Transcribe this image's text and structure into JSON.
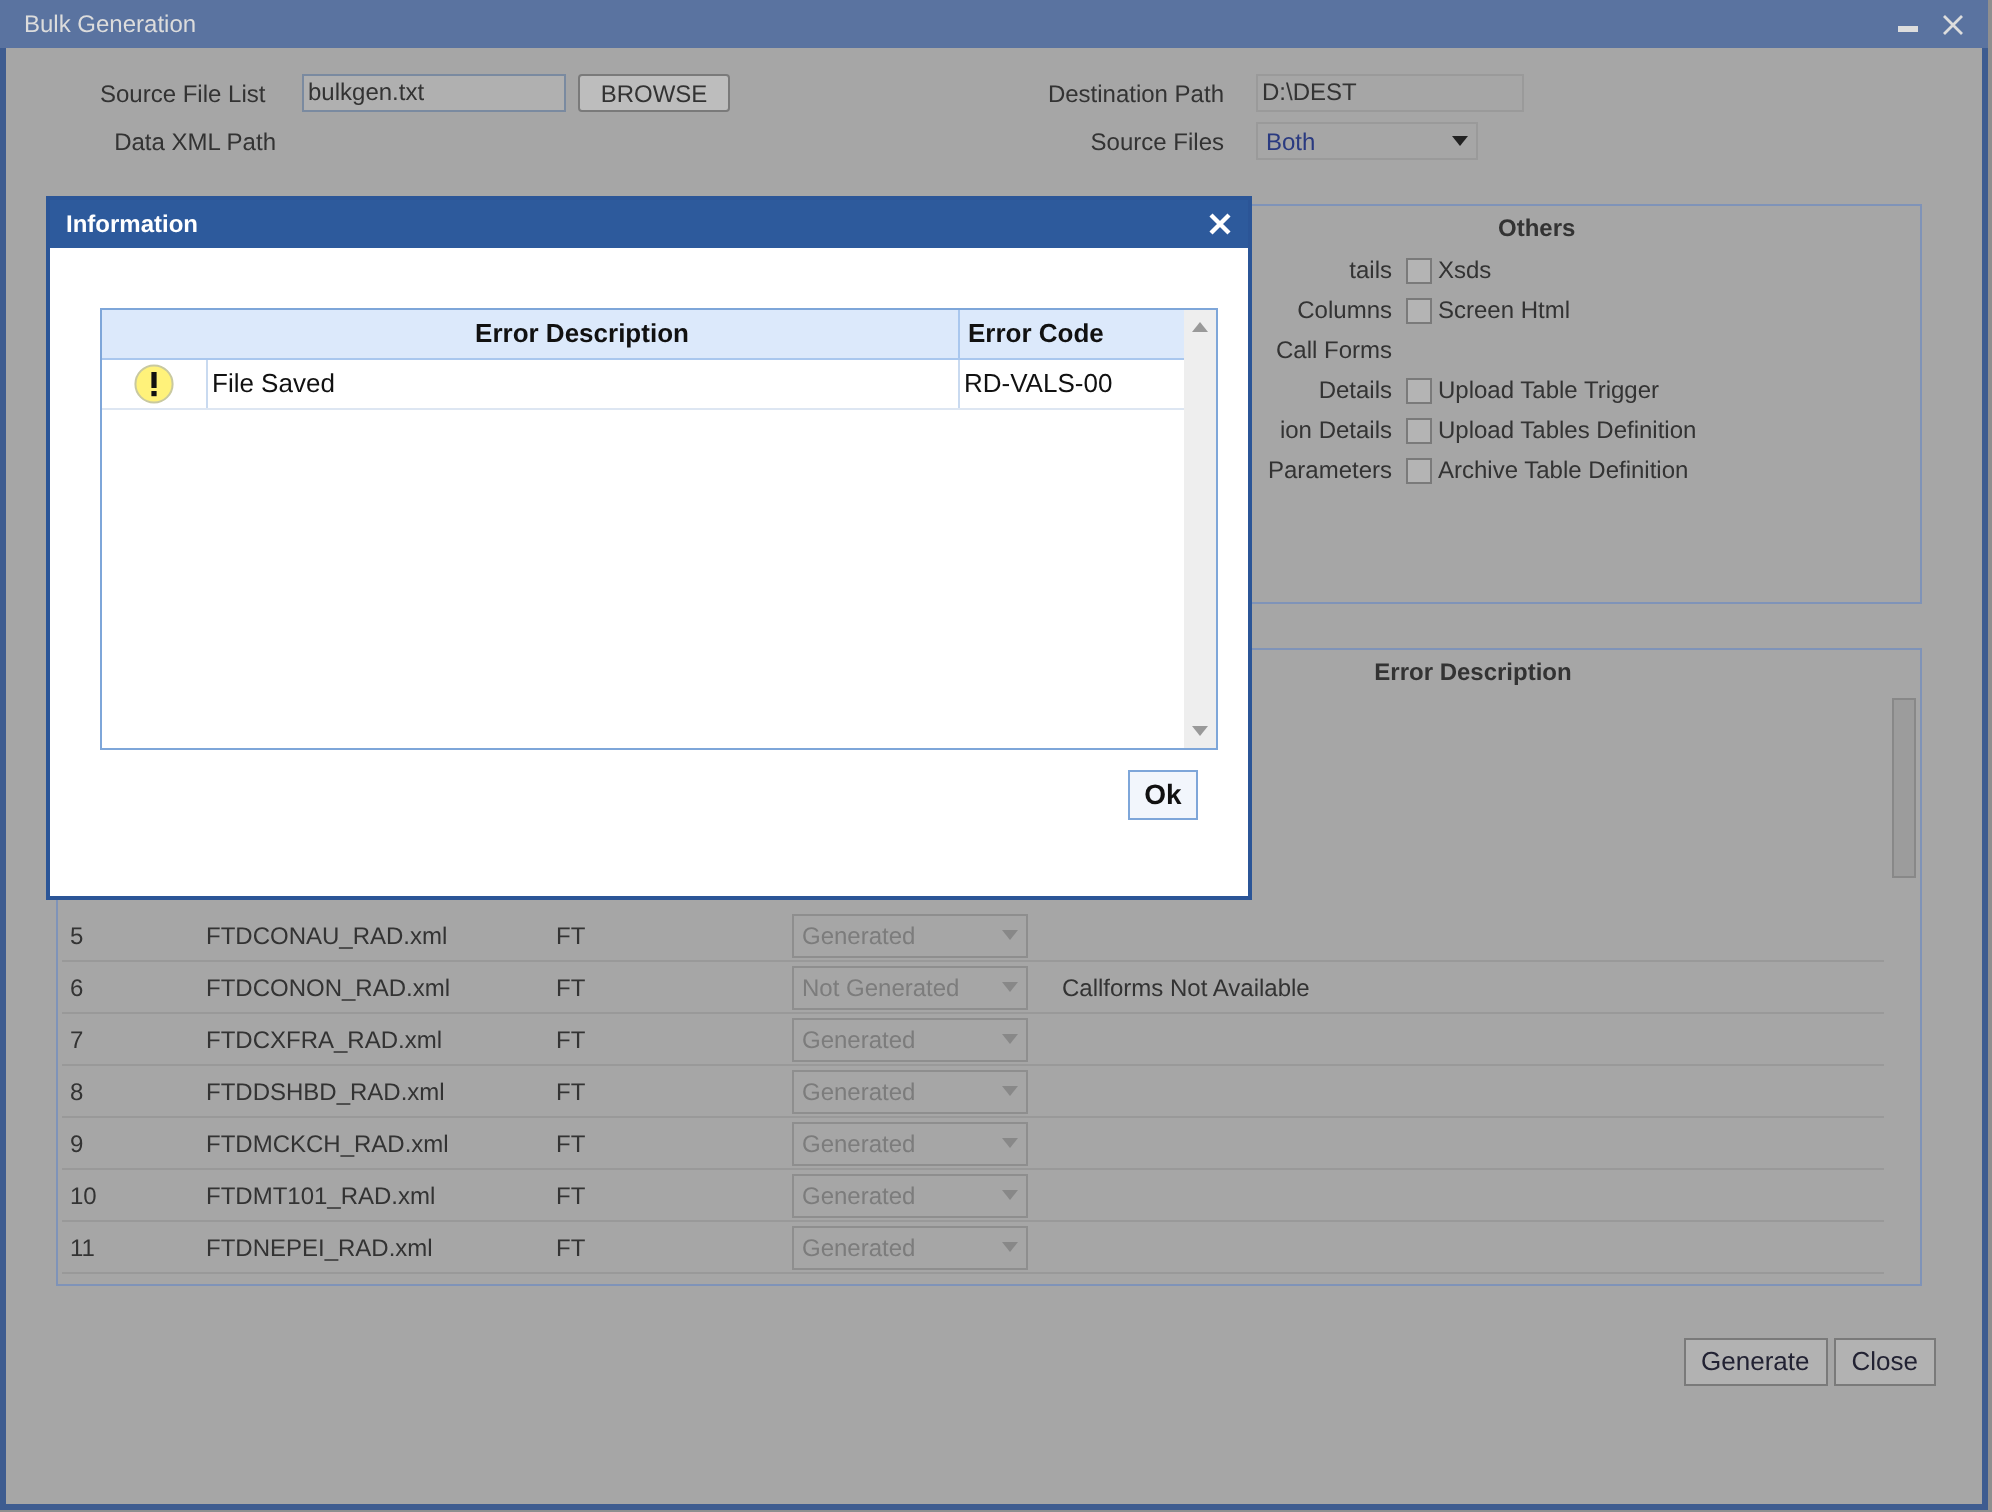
{
  "window": {
    "title": "Bulk Generation"
  },
  "source_file_list": {
    "label": "Source File List",
    "value": "bulkgen.txt"
  },
  "browse_button": "BROWSE",
  "data_xml_path": {
    "label": "Data XML Path"
  },
  "destination_path": {
    "label": "Destination Path",
    "value": "D:\\DEST"
  },
  "source_files": {
    "label": "Source Files",
    "value": "Both"
  },
  "others_panel": {
    "title": "Others",
    "rows": [
      {
        "left_label": "tails",
        "option": {
          "label": "Xsds",
          "checked": false
        }
      },
      {
        "left_label": "Columns",
        "option": {
          "label": "Screen Html",
          "checked": false
        }
      },
      {
        "left_label": "Call Forms"
      },
      {
        "left_label": "Details",
        "option": {
          "label": "Upload Table Trigger",
          "checked": false
        }
      },
      {
        "left_label": "ion Details",
        "option": {
          "label": "Upload Tables Definition",
          "checked": false
        }
      },
      {
        "left_label": "Parameters",
        "option": {
          "label": "Archive Table Definition",
          "checked": false
        }
      }
    ]
  },
  "results_table": {
    "columns": [
      "Error Description"
    ],
    "rows": [
      {
        "number": "5",
        "file": "FTDCONAU_RAD.xml",
        "module": "FT",
        "status": "Generated"
      },
      {
        "number": "6",
        "file": "FTDCONON_RAD.xml",
        "module": "FT",
        "status": "Not Generated",
        "description": "Callforms Not Available"
      },
      {
        "number": "7",
        "file": "FTDCXFRA_RAD.xml",
        "module": "FT",
        "status": "Generated"
      },
      {
        "number": "8",
        "file": "FTDDSHBD_RAD.xml",
        "module": "FT",
        "status": "Generated"
      },
      {
        "number": "9",
        "file": "FTDMCKCH_RAD.xml",
        "module": "FT",
        "status": "Generated"
      },
      {
        "number": "10",
        "file": "FTDMT101_RAD.xml",
        "module": "FT",
        "status": "Generated"
      },
      {
        "number": "11",
        "file": "FTDNEPEI_RAD.xml",
        "module": "FT",
        "status": "Generated"
      }
    ]
  },
  "buttons": [
    "Generate",
    "Close"
  ],
  "dialog": {
    "title": "Information",
    "columns": [
      "Error Description",
      "Error Code"
    ],
    "rows": [
      {
        "kind": "warning",
        "description": "File Saved",
        "code": "RD-VALS-00"
      }
    ],
    "ok_button": "Ok"
  }
}
